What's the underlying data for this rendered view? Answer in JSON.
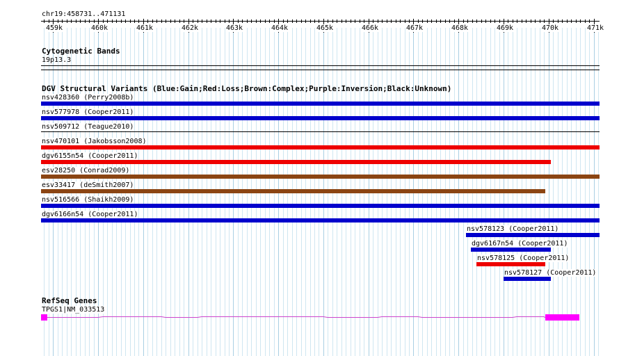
{
  "ruler": {
    "location": "chr19:458731..471131",
    "ticks": [
      "459k",
      "460k",
      "461k",
      "462k",
      "463k",
      "464k",
      "465k",
      "466k",
      "467k",
      "468k",
      "469k",
      "470k",
      "471k"
    ]
  },
  "cytoband": {
    "title": "Cytogenetic Bands",
    "band": "19p13.3"
  },
  "dgv": {
    "title": "DGV Structural Variants (Blue:Gain;Red:Loss;Brown:Complex;Purple:Inversion;Black:Unknown)",
    "colors": {
      "gain": "#0000cc",
      "loss": "#ee0000",
      "complex": "#8b4513",
      "unknown": "#000000"
    },
    "variants": [
      {
        "label": "nsv428360 (Perry2008b)",
        "type": "gain",
        "start_kb": 458.731,
        "end_kb": 471.131
      },
      {
        "label": "nsv577978 (Cooper2011)",
        "type": "gain",
        "start_kb": 458.731,
        "end_kb": 471.131
      },
      {
        "label": "nsv509712 (Teague2010)",
        "type": "unknown",
        "start_kb": 458.731,
        "end_kb": 471.131
      },
      {
        "label": "nsv470101 (Jakobsson2008)",
        "type": "loss",
        "start_kb": 458.731,
        "end_kb": 471.131
      },
      {
        "label": "dgv6155n54 (Cooper2011)",
        "type": "loss",
        "start_kb": 458.731,
        "end_kb": 470.05
      },
      {
        "label": "esv28250 (Conrad2009)",
        "type": "complex",
        "start_kb": 458.731,
        "end_kb": 471.131
      },
      {
        "label": "esv33417 (deSmith2007)",
        "type": "complex",
        "start_kb": 458.731,
        "end_kb": 469.93
      },
      {
        "label": "nsv516566 (Shaikh2009)",
        "type": "gain",
        "start_kb": 458.731,
        "end_kb": 471.131
      },
      {
        "label": "dgv6166n54 (Cooper2011)",
        "type": "gain",
        "start_kb": 458.731,
        "end_kb": 471.131
      },
      {
        "label": "nsv578123 (Cooper2011)",
        "type": "gain",
        "start_kb": 468.16,
        "end_kb": 471.131
      },
      {
        "label": "dgv6167n54 (Cooper2011)",
        "type": "gain",
        "start_kb": 468.28,
        "end_kb": 470.05
      },
      {
        "label": "nsv578125 (Cooper2011)",
        "type": "loss",
        "start_kb": 468.4,
        "end_kb": 469.93
      },
      {
        "label": "nsv578127 (Cooper2011)",
        "type": "gain",
        "start_kb": 469.0,
        "end_kb": 470.05
      }
    ]
  },
  "refseq": {
    "title": "RefSeq Genes",
    "gene_label": "TPGS1|NM_033513",
    "color": "#ff00ff",
    "intron_color": "#cc44cc",
    "start_kb": 458.731,
    "end_kb": 470.68,
    "exons": [
      {
        "start_kb": 458.731,
        "end_kb": 458.87
      },
      {
        "start_kb": 469.93,
        "end_kb": 470.68
      }
    ]
  }
}
